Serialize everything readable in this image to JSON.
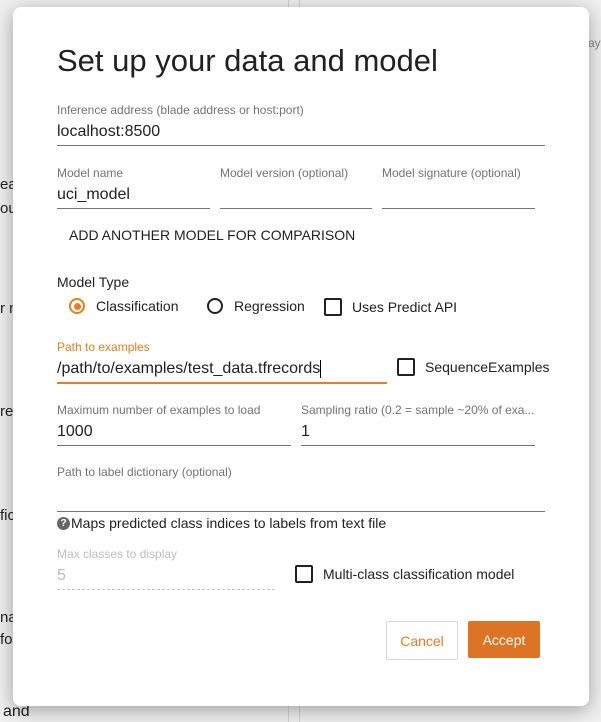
{
  "background": {
    "fragments": [
      "ea",
      "ou",
      "r n",
      "re",
      "fic",
      "na",
      "fo",
      "and",
      "ay"
    ]
  },
  "dialog": {
    "title": "Set up your data and model",
    "inference_address": {
      "label": "Inference address (blade address or host:port)",
      "value": "localhost:8500"
    },
    "model_name": {
      "label": "Model name",
      "value": "uci_model"
    },
    "model_version": {
      "label": "Model version (optional)",
      "value": ""
    },
    "model_signature": {
      "label": "Model signature (optional)",
      "value": ""
    },
    "add_model_label": "ADD ANOTHER MODEL FOR COMPARISON",
    "model_type": {
      "label": "Model Type",
      "classification": "Classification",
      "regression": "Regression",
      "predict_api": "Uses Predict API",
      "selected": "Classification"
    },
    "path_examples": {
      "label": "Path to examples",
      "value": "/path/to/examples/test_data.tfrecords"
    },
    "sequence_examples": "SequenceExamples",
    "max_examples": {
      "label": "Maximum number of examples to load",
      "value": "1000"
    },
    "sampling_ratio": {
      "label": "Sampling ratio (0.2 = sample ~20% of exa...",
      "value": "1"
    },
    "label_dict": {
      "label": "Path to label dictionary (optional)",
      "value": ""
    },
    "help_text": "Maps predicted class indices to labels from text file",
    "max_classes": {
      "label": "Max classes to display",
      "value": "5"
    },
    "multiclass": "Multi-class classification model",
    "cancel": "Cancel",
    "accept": "Accept"
  },
  "colors": {
    "accent": "#e67e22",
    "accept_bg": "#dd7425"
  }
}
